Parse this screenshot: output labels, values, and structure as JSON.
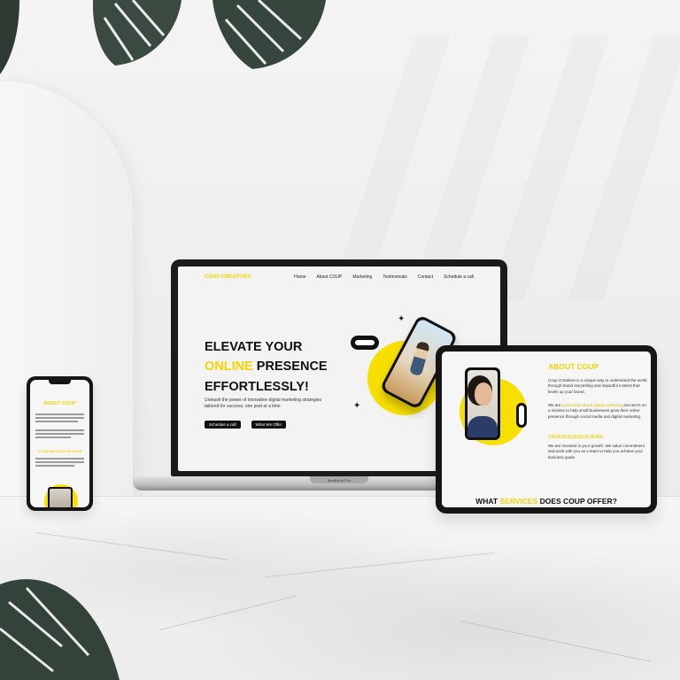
{
  "laptop": {
    "brand": "MacBook Pro",
    "site": {
      "logo": "COUP CREATIVES",
      "nav": [
        "Home",
        "About COUP",
        "Marketing",
        "Testimonials",
        "Contact",
        "Schedule a call"
      ],
      "hero": {
        "line1": "ELEVATE YOUR",
        "line2_accent": "ONLINE",
        "line2_rest": " PRESENCE",
        "line3": "EFFORTLESSLY!",
        "subtitle": "Unleash the power of innovative digital marketing strategies tailored for success, one post at a time",
        "button_primary": "Schedule a call",
        "button_secondary": "What We Offer"
      }
    }
  },
  "tablet": {
    "about_title": "ABOUT COUP",
    "para1": "Coup Creatives is a unique way to understand the world through brand storytelling and impactful content that levels up your brand.",
    "para2_pre": "We are ",
    "para2_accent": "passionate about digital marketing",
    "para2_post": " and we're on a mission to help small businesses grow their online presence through social media and digital marketing.",
    "subhead": "YOUR SUCCESS IS OURS",
    "para3": "We are invested in your growth. We value commitment and work with you as a team to help you achieve your business goals.",
    "services_pre": "WHAT ",
    "services_accent": "SERVICES",
    "services_post": " DOES COUP OFFER?"
  },
  "phone": {
    "about_title": "ABOUT COUP",
    "subhead": "YOUR SUCCESS IS OURS"
  },
  "colors": {
    "accent": "#f5d400",
    "dark": "#111111",
    "screen_bg": "#f3f3f3"
  }
}
